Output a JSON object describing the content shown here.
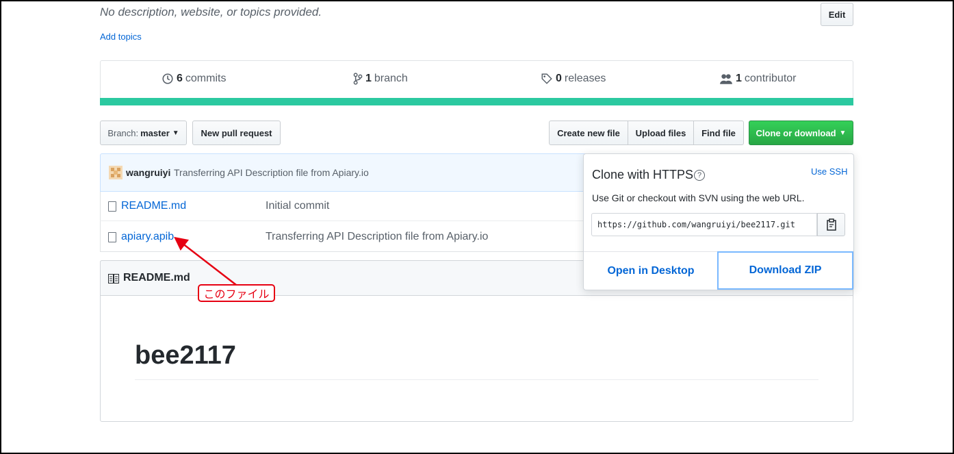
{
  "repo": {
    "description": "No description, website, or topics provided.",
    "add_topics": "Add topics",
    "edit_label": "Edit"
  },
  "stats": [
    {
      "icon": "history-icon",
      "count": "6",
      "label": "commits"
    },
    {
      "icon": "branch-icon",
      "count": "1",
      "label": "branch"
    },
    {
      "icon": "tag-icon",
      "count": "0",
      "label": "releases"
    },
    {
      "icon": "people-icon",
      "count": "1",
      "label": "contributor"
    }
  ],
  "toolbar": {
    "branch_prefix": "Branch:",
    "branch_name": "master",
    "new_pull_request": "New pull request",
    "create_new_file": "Create new file",
    "upload_files": "Upload files",
    "find_file": "Find file",
    "clone_or_download": "Clone or download"
  },
  "latest_commit": {
    "author": "wangruiyi",
    "message": "Transferring API Description file from Apiary.io"
  },
  "files": [
    {
      "name": "README.md",
      "message": "Initial commit"
    },
    {
      "name": "apiary.apib",
      "message": "Transferring API Description file from Apiary.io"
    }
  ],
  "readme": {
    "header": "README.md",
    "heading": "bee2117"
  },
  "clone_popup": {
    "title": "Clone with HTTPS",
    "use_ssh": "Use SSH",
    "description": "Use Git or checkout with SVN using the web URL.",
    "url": "https://github.com/wangruiyi/bee2117.git",
    "open_in_desktop": "Open in Desktop",
    "download_zip": "Download ZIP"
  },
  "annotation": {
    "text": "このファイル",
    "color": "#e60012"
  },
  "colors": {
    "accent_green": "#28a745",
    "stats_bar": "#2bc9a0",
    "link": "#0366d6"
  }
}
